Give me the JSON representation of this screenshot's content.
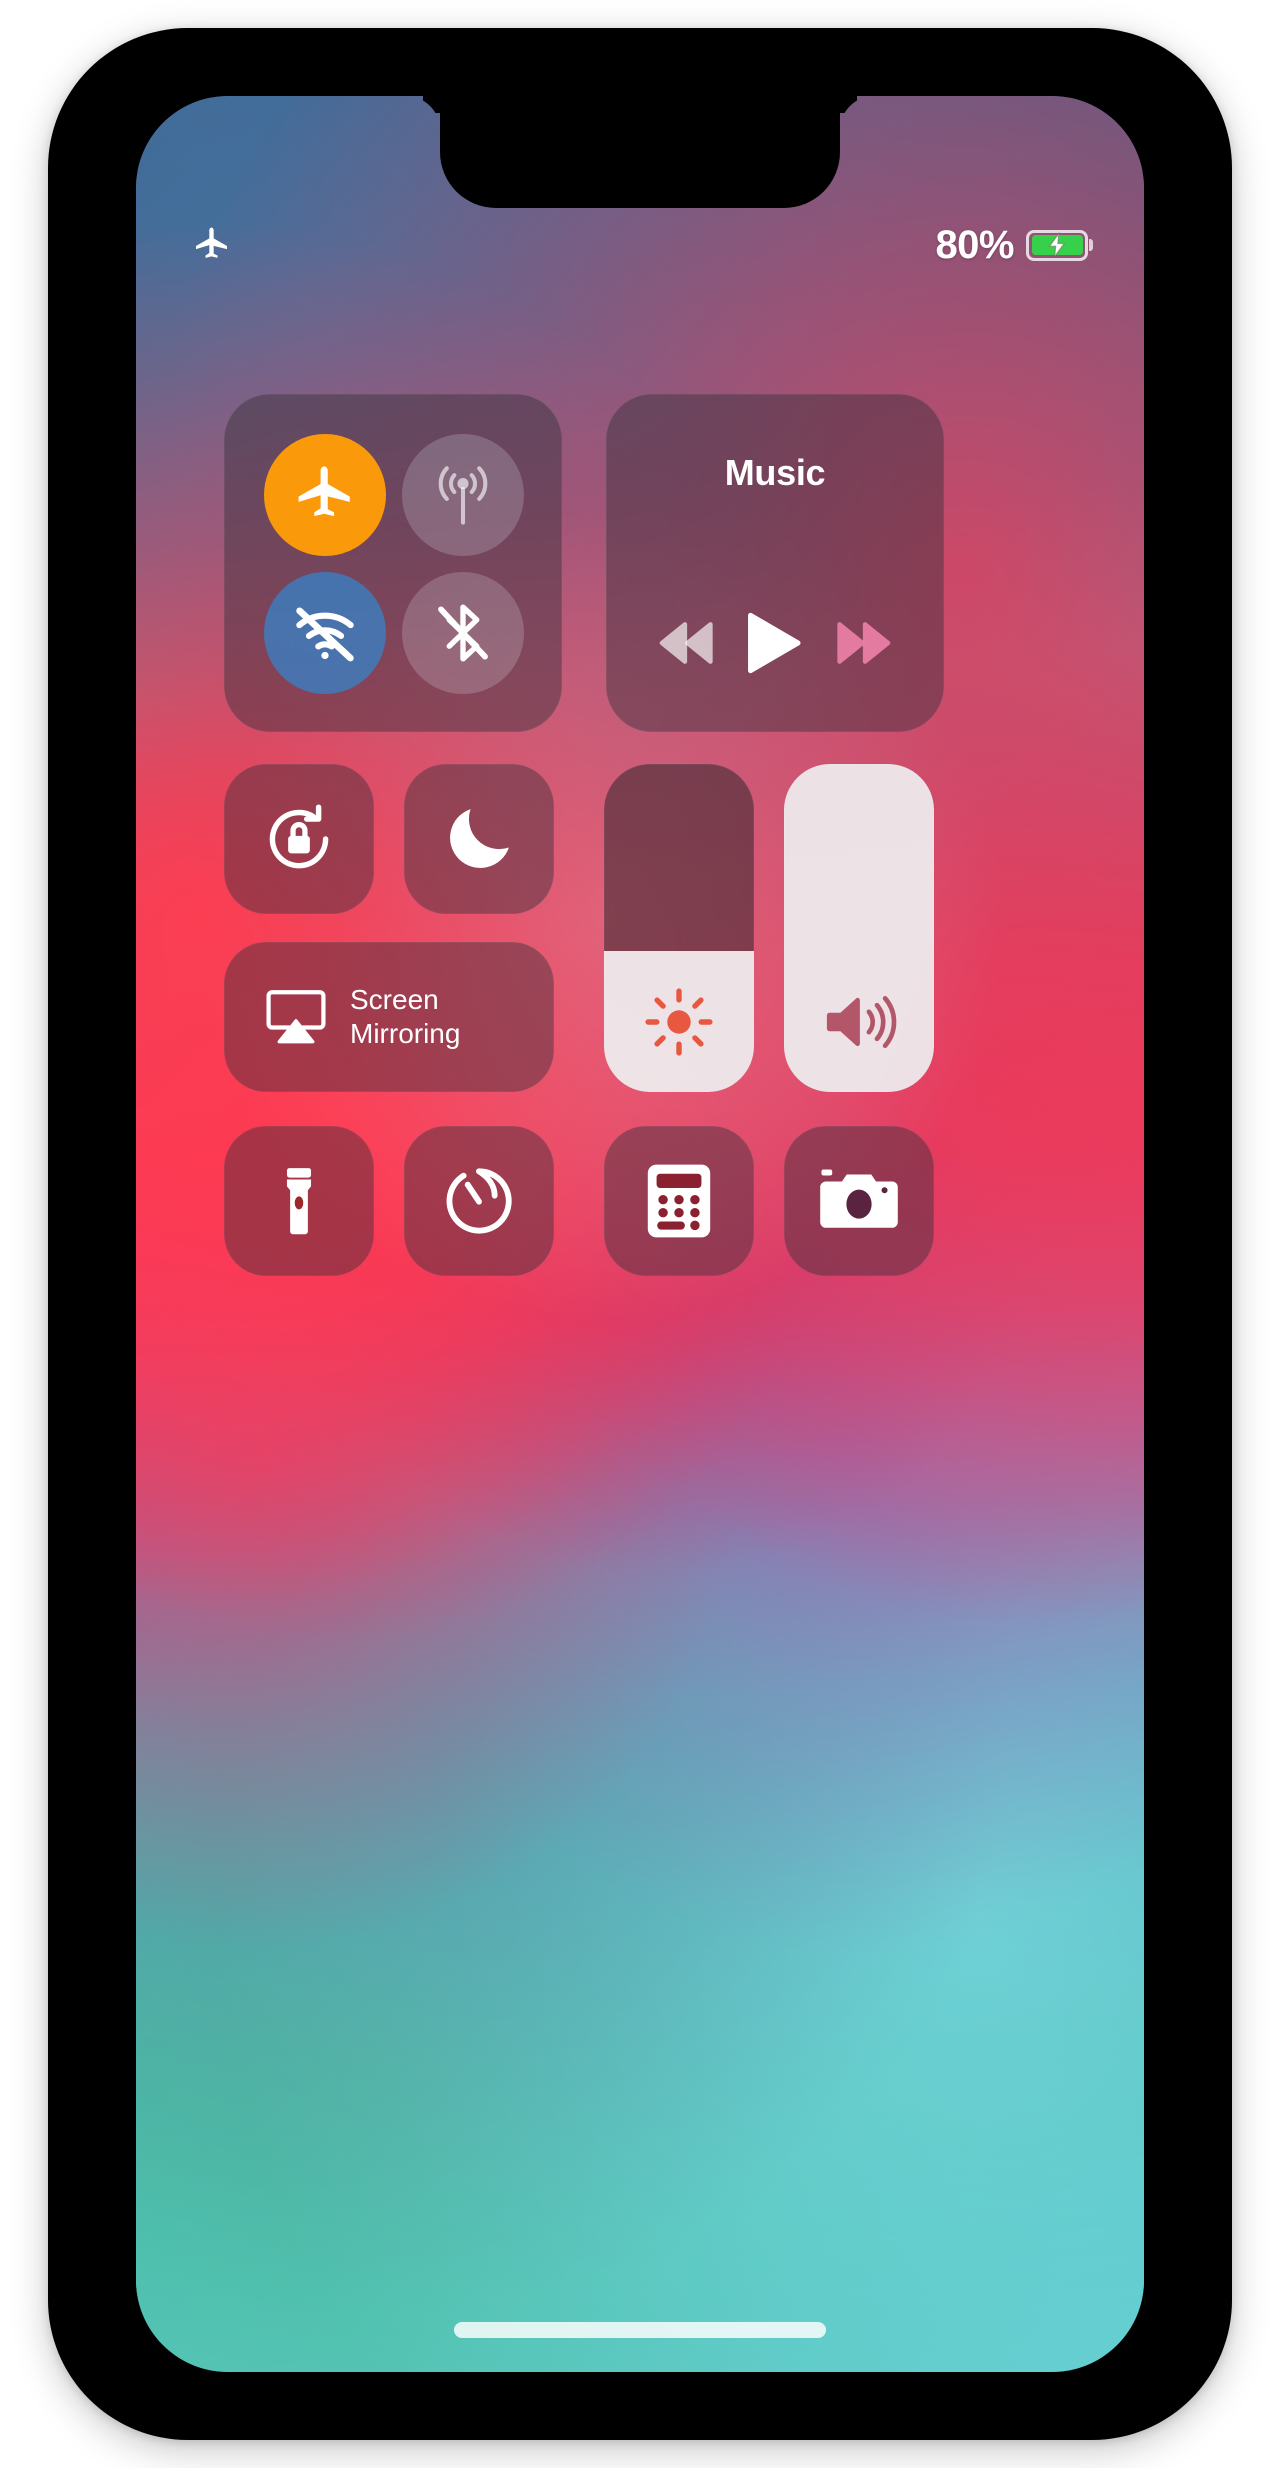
{
  "device": {
    "name": "iphone-x",
    "screen_label": "Control Center"
  },
  "status_bar": {
    "airplane_icon": "airplane-icon",
    "battery_percent": "80%",
    "battery_level": 80,
    "battery_charging": true,
    "battery_fill_color": "#37d04a",
    "battery_icon": "battery-charging-icon"
  },
  "connectivity": {
    "module_name": "connectivity-module",
    "buttons": [
      {
        "name": "airplane-mode-toggle",
        "icon": "airplane-icon",
        "label": "Airplane Mode",
        "state": "on",
        "color": "#fa9a0b"
      },
      {
        "name": "cellular-data-toggle",
        "icon": "cellular-antenna-icon",
        "label": "Cellular Data",
        "state": "dim",
        "color": "rgba(230,238,248,0.20)"
      },
      {
        "name": "wifi-toggle",
        "icon": "wifi-off-icon",
        "label": "Wi-Fi",
        "state": "off-blue",
        "color": "rgba(56,128,196,0.78)"
      },
      {
        "name": "bluetooth-toggle",
        "icon": "bluetooth-off-icon",
        "label": "Bluetooth",
        "state": "dim",
        "color": "rgba(230,238,248,0.20)"
      }
    ]
  },
  "music": {
    "module_name": "music-module",
    "title": "Music",
    "controls": [
      {
        "name": "rewind-button",
        "icon": "rewind-icon",
        "label": "Rewind"
      },
      {
        "name": "play-button",
        "icon": "play-icon",
        "label": "Play"
      },
      {
        "name": "fast-forward-button",
        "icon": "fast-forward-icon",
        "label": "Fast Forward"
      }
    ]
  },
  "toggles": [
    {
      "name": "rotation-lock-toggle",
      "icon": "rotation-lock-icon",
      "label": "Portrait Orientation Lock",
      "state": "off"
    },
    {
      "name": "do-not-disturb-toggle",
      "icon": "moon-icon",
      "label": "Do Not Disturb",
      "state": "off"
    }
  ],
  "screen_mirroring": {
    "name": "screen-mirroring-tile",
    "icon": "airplay-icon",
    "label": "Screen\nMirroring"
  },
  "sliders": [
    {
      "name": "brightness-slider",
      "icon": "brightness-sun-icon",
      "label": "Brightness",
      "value": 43,
      "icon_color": "#e8573f"
    },
    {
      "name": "volume-slider",
      "icon": "speaker-waves-icon",
      "label": "Volume",
      "value": 100,
      "icon_color": "#b4566a"
    }
  ],
  "utilities": [
    {
      "name": "flashlight-tile",
      "icon": "flashlight-icon",
      "label": "Flashlight"
    },
    {
      "name": "timer-tile",
      "icon": "timer-icon",
      "label": "Timer"
    },
    {
      "name": "calculator-tile",
      "icon": "calculator-icon",
      "label": "Calculator"
    },
    {
      "name": "camera-tile",
      "icon": "camera-icon",
      "label": "Camera"
    }
  ],
  "home_indicator": {
    "name": "home-indicator",
    "label": "Home Indicator"
  }
}
